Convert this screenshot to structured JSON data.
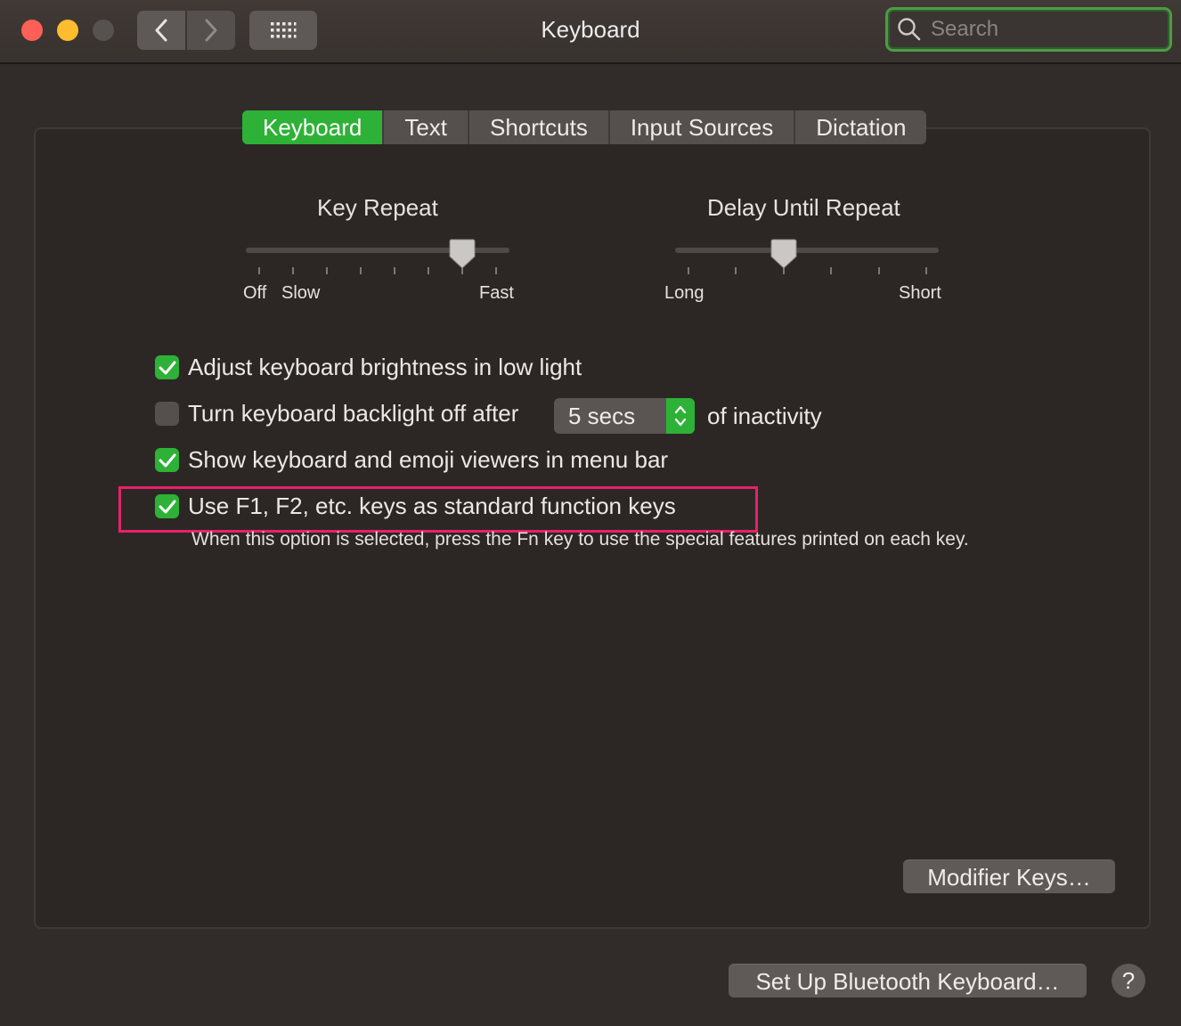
{
  "window": {
    "title": "Keyboard"
  },
  "toolbar": {
    "search_placeholder": "Search"
  },
  "tabs": [
    {
      "label": "Keyboard",
      "active": true
    },
    {
      "label": "Text",
      "active": false
    },
    {
      "label": "Shortcuts",
      "active": false
    },
    {
      "label": "Input Sources",
      "active": false
    },
    {
      "label": "Dictation",
      "active": false
    }
  ],
  "key_repeat": {
    "title": "Key Repeat",
    "labels": {
      "off": "Off",
      "slow": "Slow",
      "fast": "Fast"
    },
    "stops": 8,
    "selected_stop": 6
  },
  "delay_until_repeat": {
    "title": "Delay Until Repeat",
    "labels": {
      "long": "Long",
      "short": "Short"
    },
    "stops": 6,
    "selected_stop": 2
  },
  "options": {
    "brightness": {
      "label": "Adjust keyboard brightness in low light",
      "checked": true
    },
    "backlight": {
      "label": "Turn keyboard backlight off after",
      "checked": false,
      "value": "5 secs",
      "suffix": "of inactivity"
    },
    "viewers": {
      "label": "Show keyboard and emoji viewers in menu bar",
      "checked": true
    },
    "fn_keys": {
      "label": "Use F1, F2, etc. keys as standard function keys",
      "checked": true,
      "help": "When this option is selected, press the Fn key to use the special features printed on each key."
    }
  },
  "buttons": {
    "modifier_keys": "Modifier Keys…",
    "bluetooth": "Set Up Bluetooth Keyboard…",
    "help": "?"
  },
  "colors": {
    "accent": "#2eb137",
    "highlight": "#e8206a"
  }
}
